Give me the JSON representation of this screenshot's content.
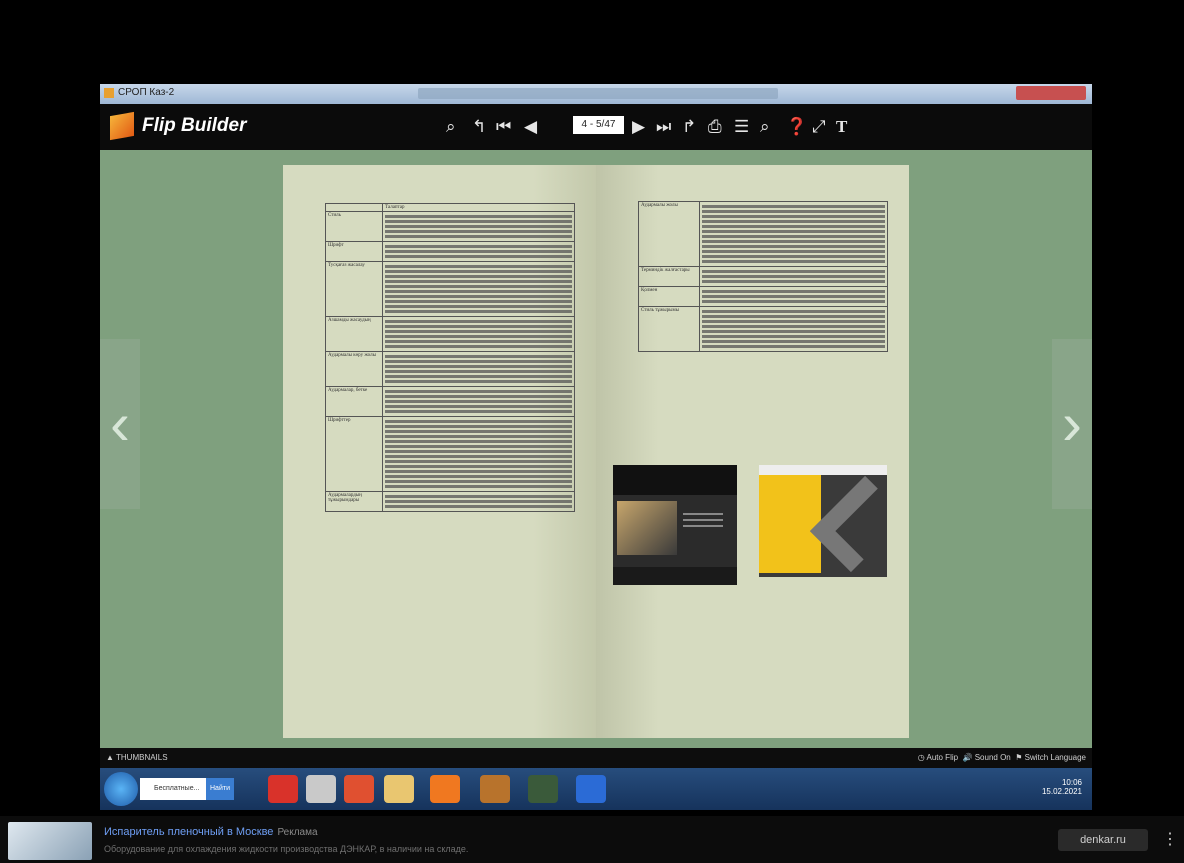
{
  "window": {
    "title": "СРОП Каз-2"
  },
  "toolbar": {
    "logo_text": "Flip Builder",
    "page_indicator": "4 - 5/47",
    "icons": [
      "zoom-in-icon",
      "undo-icon",
      "first-page-icon",
      "prev-page-icon",
      "next-page-icon",
      "last-page-icon",
      "redo-icon",
      "print-icon",
      "contents-icon",
      "search-icon",
      "help-icon",
      "fullscreen-icon",
      "text-icon"
    ]
  },
  "book": {
    "left_table": {
      "header": "Талаптар",
      "rows": [
        "Стиль",
        "Шрифт",
        "Тусқағаз жасалау",
        "Азшамды жасаудың",
        "Аудармалы көру жолы",
        "Аудармалар, бетке",
        "Шрифттер",
        "Аудармалардың тұжырымдары"
      ]
    },
    "right_table": {
      "rows": [
        "Аудармалы жолы",
        "Терминдік жалғастары",
        "Қолмен",
        "Стиль тұжырымы"
      ]
    }
  },
  "bottom_bar": {
    "thumbnails": "THUMBNAILS",
    "auto_flip": "Auto Flip",
    "sound": "Sound On",
    "language": "Switch Language"
  },
  "taskbar": {
    "search_placeholder": "Бесплатные...",
    "search_button": "Найти",
    "time": "10:06",
    "date": "15.02.2021"
  },
  "ad": {
    "title": "Испаритель пленочный в Москве",
    "source": "Реклама",
    "description": "Оборудование для охлаждения жидкости производства ДЭНКАР, в наличии на складе.",
    "link": "denkar.ru"
  }
}
